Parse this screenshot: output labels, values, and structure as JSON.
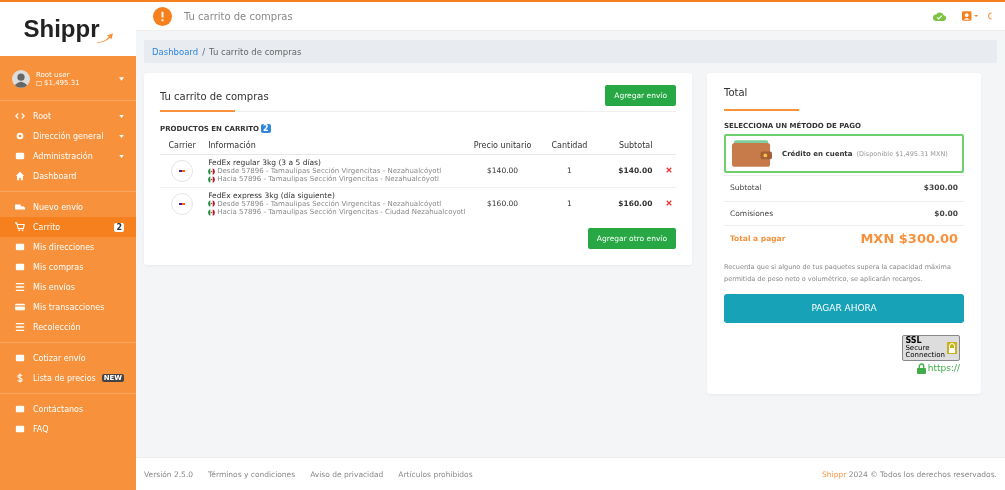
{
  "brand": "Shippr",
  "topbar": {
    "title": "Tu carrito de compras"
  },
  "user": {
    "name": "Root user",
    "balance": "$1,495.31"
  },
  "sidebar": {
    "groups": [
      {
        "items": [
          {
            "label": "Root",
            "expandable": true,
            "selected": false
          },
          {
            "label": "Dirección general",
            "expandable": true,
            "selected": false
          },
          {
            "label": "Administración",
            "expandable": true,
            "selected": false
          },
          {
            "label": "Dashboard",
            "expandable": false,
            "selected": false
          }
        ]
      },
      {
        "items": [
          {
            "label": "Nuevo envío",
            "expandable": false,
            "selected": false
          },
          {
            "label": "Carrito",
            "expandable": false,
            "selected": true,
            "badge": "2"
          },
          {
            "label": "Mis direcciones",
            "expandable": false,
            "selected": false
          },
          {
            "label": "Mis compras",
            "expandable": false,
            "selected": false
          },
          {
            "label": "Mis envíos",
            "expandable": false,
            "selected": false
          },
          {
            "label": "Mis transacciones",
            "expandable": false,
            "selected": false
          },
          {
            "label": "Recolección",
            "expandable": false,
            "selected": false
          }
        ]
      },
      {
        "items": [
          {
            "label": "Cotizar envío",
            "expandable": false,
            "selected": false
          },
          {
            "label": "Lista de precios",
            "expandable": false,
            "selected": false,
            "tag": "NEW"
          }
        ]
      },
      {
        "items": [
          {
            "label": "Contáctanos",
            "expandable": false,
            "selected": false
          },
          {
            "label": "FAQ",
            "expandable": false,
            "selected": false
          }
        ]
      }
    ]
  },
  "breadcrumb": [
    "Dashboard",
    "Tu carrito de compras"
  ],
  "breadcrumb_separator": "/",
  "cart": {
    "title": "Tu carrito de compras",
    "add_button": "Agregar envío",
    "section": "PRODUCTOS EN CARRITO",
    "count": "2",
    "columns": [
      "Carrier",
      "Información",
      "Precio unitario",
      "Cantidad",
      "Subtotal"
    ],
    "rows": [
      {
        "service": "FedEx regular 3kg (3 a 5 días)",
        "from": "Desde 57896 - Tamaulipas Sección Virgencitas - Nezahualcóyotl",
        "to": "Hacia 57896 - Tamaulipas Sección Virgencitas - Nezahualcóyotl",
        "price": "$140.00",
        "qty": "1",
        "subtotal": "$140.00"
      },
      {
        "service": "FedEx express 3kg (día siguiente)",
        "from": "Desde 57896 - Tamaulipas Sección Virgencitas - Nezahualcóyotl",
        "to": "Hacia 57896 - Tamaulipas Sección Virgencitas - Ciudad Nezahualcoyotl",
        "price": "$160.00",
        "qty": "1",
        "subtotal": "$160.00"
      }
    ],
    "add_other_button": "Agregar otro envío"
  },
  "total": {
    "title": "Total",
    "method_heading": "SELECCIONA UN MÉTODO DE PAGO",
    "methods": [
      {
        "label": "Crédito en cuenta",
        "note": "(Disponible $1,495.31 MXN)",
        "selected": true
      }
    ],
    "lines": [
      {
        "label": "Subtotal",
        "value": "$300.00"
      },
      {
        "label": "Comisiones",
        "value": "$0.00"
      }
    ],
    "grand_label": "Total a pagar",
    "grand_value": "MXN $300.00",
    "notice": "Recuerda que si alguno de tus paquetes supera la capacidad máxima permitida de peso neto o volumétrico, se aplicarán recargos.",
    "pay_button": "PAGAR AHORA",
    "ssl": [
      "SSL",
      "Secure",
      "Connection"
    ],
    "https": "https://"
  },
  "footer": {
    "links": [
      "Versión 2.5.0",
      "Términos y condiciones",
      "Aviso de privacidad",
      "Artículos prohibidos"
    ],
    "brand": "Shippr",
    "copyright": " 2024 © Todos los derechos reservados."
  }
}
